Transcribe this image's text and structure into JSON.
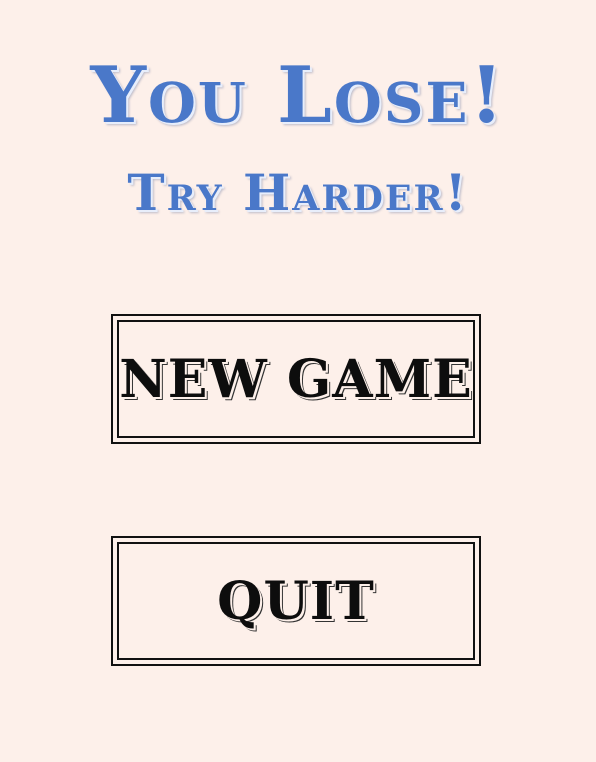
{
  "screen": {
    "headline": "You Lose!",
    "subheadline": "Try Harder!"
  },
  "menu": {
    "new_game_label": "NEW GAME",
    "quit_label": "QUIT"
  },
  "colors": {
    "background": "#fdf0ea",
    "headline": "#4a78c9",
    "button_ink": "#111111"
  }
}
